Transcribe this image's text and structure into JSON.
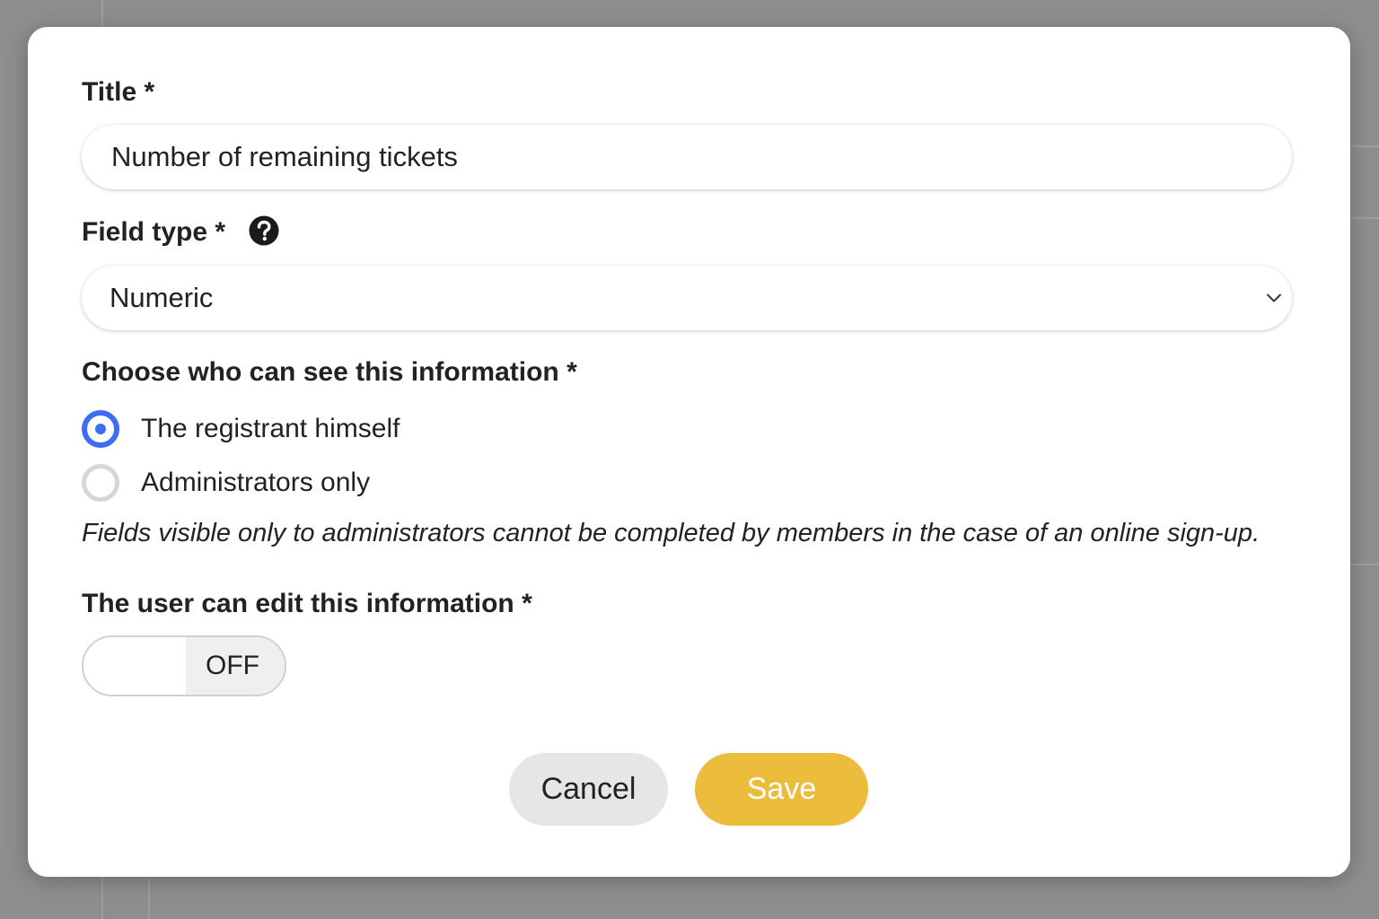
{
  "title_field": {
    "label": "Title *",
    "value": "Number of remaining tickets"
  },
  "field_type": {
    "label": "Field type *",
    "help_icon": "question-circle-icon",
    "selected": "Numeric",
    "dropdown_icon": "chevron-down-icon"
  },
  "visibility": {
    "label": "Choose who can see this information *",
    "options": [
      {
        "label": "The registrant himself",
        "checked": true
      },
      {
        "label": "Administrators only",
        "checked": false
      }
    ],
    "note": "Fields visible only to administrators cannot be completed by members in the case of an online sign-up."
  },
  "editable": {
    "label": "The user can edit this information *",
    "state": "OFF"
  },
  "actions": {
    "cancel_label": "Cancel",
    "save_label": "Save"
  },
  "colors": {
    "accent": "#3d6ef0",
    "save_button": "#ecbc3c",
    "cancel_button": "#e6e6e6",
    "overlay": "#8e8e8e"
  }
}
